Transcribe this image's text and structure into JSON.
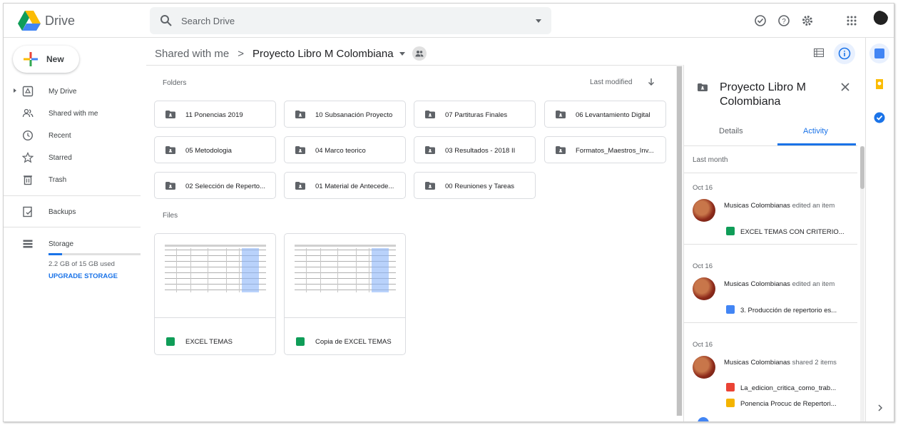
{
  "app": {
    "title": "Drive"
  },
  "search": {
    "placeholder": "Search Drive"
  },
  "sidebar": {
    "new_label": "New",
    "items": [
      {
        "label": "My Drive"
      },
      {
        "label": "Shared with me"
      },
      {
        "label": "Recent"
      },
      {
        "label": "Starred"
      },
      {
        "label": "Trash"
      },
      {
        "label": "Backups"
      },
      {
        "label": "Storage"
      }
    ],
    "storage_used": "2.2 GB of 15 GB used",
    "storage_fraction": 0.147,
    "upgrade_label": "UPGRADE STORAGE"
  },
  "breadcrumb": {
    "parent": "Shared with me",
    "separator": ">",
    "current": "Proyecto Libro M Colombiana"
  },
  "main": {
    "folders_label": "Folders",
    "sort_label": "Last modified",
    "folders": [
      "11 Ponencias 2019",
      "10 Subsanación Proyecto",
      "07 Partituras Finales",
      "06 Levantamiento Digital",
      "05 Metodologia",
      "04 Marco teorico",
      "03 Resultados - 2018 II",
      "Formatos_Maestros_Inv...",
      "02 Selección de Reperto...",
      "01 Material de Antecede...",
      "00 Reuniones y Tareas"
    ],
    "files_label": "Files",
    "files": [
      "EXCEL TEMAS",
      "Copia de EXCEL TEMAS"
    ]
  },
  "details": {
    "title": "Proyecto Libro M Colombiana",
    "tabs": [
      "Details",
      "Activity"
    ],
    "active_tab": "Activity",
    "period": "Last month",
    "activities": [
      {
        "date": "Oct 16",
        "user": "Musicas Colombianas",
        "action": "edited an item",
        "items": [
          {
            "name": "EXCEL TEMAS CON CRITERIO...",
            "type": "sheet"
          }
        ]
      },
      {
        "date": "Oct 16",
        "user": "Musicas Colombianas",
        "action": "edited an item",
        "items": [
          {
            "name": "3. Producción de repertorio es...",
            "type": "doc"
          }
        ]
      },
      {
        "date": "Oct 16",
        "user": "Musicas Colombianas",
        "action": "shared 2 items",
        "items": [
          {
            "name": "La_edicion_critica_como_trab...",
            "type": "pdf"
          },
          {
            "name": "Ponencia Procuc de Repertori...",
            "type": "slides"
          }
        ]
      }
    ]
  },
  "colors": {
    "accent": "#1a73e8",
    "sheet": "#0f9d58",
    "doc": "#4285f4",
    "pdf": "#ea4335",
    "slides": "#f4b400"
  }
}
